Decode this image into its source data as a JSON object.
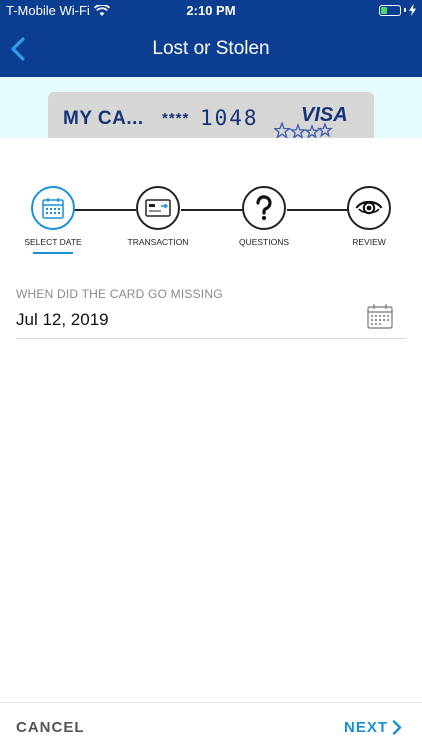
{
  "status_bar": {
    "carrier": "T-Mobile Wi-Fi",
    "time": "2:10 PM",
    "battery_level": 0.35
  },
  "nav": {
    "title": "Lost or Stolen",
    "back_icon": "chevron-left-icon"
  },
  "card": {
    "name": "MY CA...",
    "mask": "****",
    "last_digits": "1048",
    "brand": "VISA"
  },
  "steps": [
    {
      "label": "SELECT DATE",
      "icon": "calendar-icon",
      "active": true
    },
    {
      "label": "TRANSACTION",
      "icon": "credit-card-icon",
      "active": false
    },
    {
      "label": "QUESTIONS",
      "icon": "question-icon",
      "active": false
    },
    {
      "label": "REVIEW",
      "icon": "eye-icon",
      "active": false
    }
  ],
  "date_field": {
    "label": "WHEN DID THE CARD GO MISSING",
    "value": "Jul 12, 2019"
  },
  "footer": {
    "cancel_label": "CANCEL",
    "next_label": "NEXT"
  },
  "colors": {
    "nav_background": "#0b3d91",
    "accent": "#1a8fd6",
    "card_area_background": "#e6fbfc",
    "card_text": "#16337a"
  }
}
